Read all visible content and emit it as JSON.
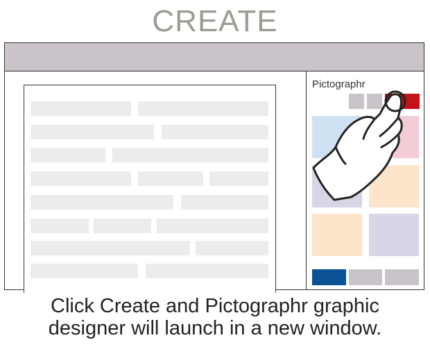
{
  "heading": "CREATE",
  "panel": {
    "title": "Pictographr"
  },
  "caption": {
    "line1": "Click Create and Pictographr graphic",
    "line2": "designer will launch in a new window."
  },
  "icons": {
    "pointer": "pointing-hand-icon"
  },
  "colors": {
    "titlebar": "#cac3ca",
    "create_button": "#c41218",
    "primary_button": "#0b5394",
    "tile_blue": "#cfe2f3",
    "tile_pink": "#f4ccd6",
    "tile_lavender": "#d9d4e6",
    "tile_peach": "#fde5cc"
  }
}
